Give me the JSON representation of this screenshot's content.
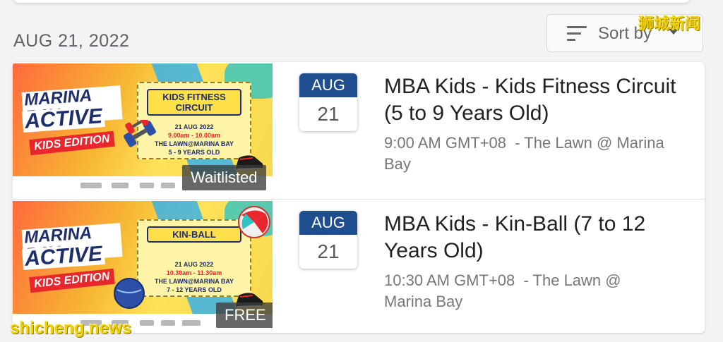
{
  "date_header": "AUG 21, 2022",
  "sort": {
    "label": "Sort by",
    "icon": "sort-lines-icon"
  },
  "watermarks": {
    "top_right": "狮城新闻",
    "bottom_left": "shicheng.news"
  },
  "events": [
    {
      "month": "AUG",
      "day": "21",
      "title": "MBA Kids - Kids Fitness Circuit (5 to 9 Years Old)",
      "time": "9:00 AM GMT+08",
      "location": "- The Lawn @ Marina Bay",
      "badge": "Waitlisted",
      "banner": {
        "logo_line1": "MARINA BAY",
        "logo_line2": "ACTIVE",
        "logo_line3": "KIDS EDITION",
        "title": "KIDS FITNESS CIRCUIT",
        "date": "21 AUG 2022",
        "time": "9.00am - 10.00am",
        "venue": "THE LAWN@MARINA BAY",
        "ages": "5 - 9 YEARS OLD"
      }
    },
    {
      "month": "AUG",
      "day": "21",
      "title": "MBA Kids - Kin-Ball (7 to 12 Years Old)",
      "time": "10:30 AM GMT+08",
      "location": "- The Lawn @ Marina Bay",
      "badge": "FREE",
      "banner": {
        "logo_line1": "MARINA BAY",
        "logo_line2": "ACTIVE",
        "logo_line3": "KIDS EDITION",
        "title": "KIN-BALL",
        "date": "21 AUG 2022",
        "time": "10.30am - 11.30am",
        "venue": "THE LAWN@MARINA BAY",
        "ages": "7 - 12 YEARS OLD"
      }
    }
  ],
  "colors": {
    "calendar_header": "#1f4e8f",
    "watermark": "#f2d200",
    "badge_bg": "#3c3c3c"
  }
}
